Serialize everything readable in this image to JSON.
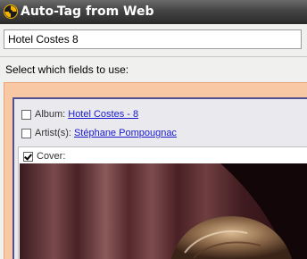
{
  "window": {
    "title": "Auto-Tag from Web",
    "icon": "app-logo-icon"
  },
  "search": {
    "value": "Hotel Costes 8"
  },
  "fields": {
    "prompt": "Select which fields to use:",
    "album": {
      "label": "Album:",
      "value": "Hotel Costes - 8",
      "checked": false
    },
    "artist": {
      "label": "Artist(s):",
      "value": "Stéphane Pompougnac",
      "checked": false
    },
    "cover": {
      "label": "Cover:",
      "checked": true
    }
  },
  "colors": {
    "outer_panel": "#f8c7a4",
    "inner_border": "#52508e",
    "link": "#1a1acc"
  }
}
